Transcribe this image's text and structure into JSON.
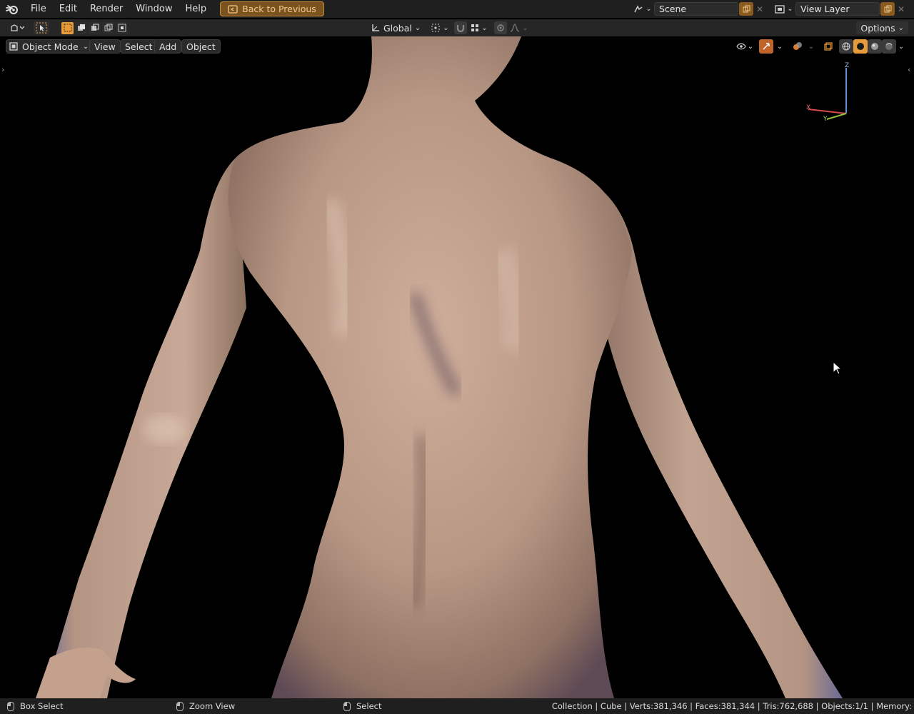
{
  "menu": {
    "items": [
      "File",
      "Edit",
      "Render",
      "Window",
      "Help"
    ],
    "back_label": "Back to Previous"
  },
  "scene": {
    "name": "Scene"
  },
  "view_layer": {
    "name": "View Layer"
  },
  "toolheader": {
    "orientation": "Global",
    "options_label": "Options"
  },
  "viewport": {
    "mode": "Object Mode",
    "menus": [
      "View",
      "Select",
      "Add",
      "Object"
    ],
    "gizmo": {
      "z": "Z",
      "x": "X",
      "y": "Y"
    }
  },
  "statusbar": {
    "hint_left": "Box Select",
    "hint_middle": "Zoom View",
    "hint_right": "Select",
    "stats": "Collection | Cube | Verts:381,346 | Faces:381,344 | Tris:762,688 | Objects:1/1 | Memory:"
  },
  "colors": {
    "accent": "#e89b3a",
    "header_bg": "#1f1f1f",
    "skin": "#c9a48f"
  }
}
